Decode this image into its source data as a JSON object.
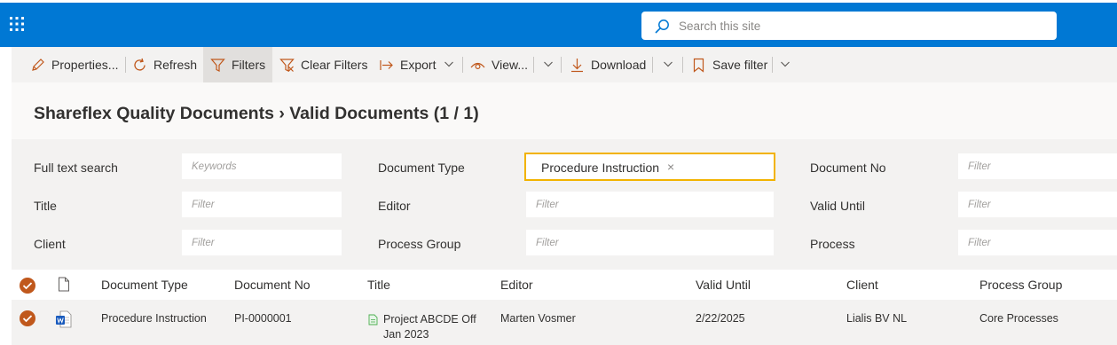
{
  "search": {
    "placeholder": "Search this site"
  },
  "commands": {
    "properties": "Properties...",
    "refresh": "Refresh",
    "filters": "Filters",
    "clear_filters": "Clear Filters",
    "export": "Export",
    "view": "View...",
    "download": "Download",
    "save_filter": "Save filter"
  },
  "page_title": "Shareflex Quality Documents › Valid Documents (1 / 1)",
  "filters": {
    "full_text_search": {
      "label": "Full text search",
      "placeholder": "Keywords"
    },
    "document_type": {
      "label": "Document Type",
      "selected_tag": "Procedure Instruction",
      "remove_glyph": "×"
    },
    "document_no": {
      "label": "Document No",
      "placeholder": "Filter"
    },
    "title": {
      "label": "Title",
      "placeholder": "Filter"
    },
    "editor": {
      "label": "Editor",
      "placeholder": "Filter"
    },
    "valid_until": {
      "label": "Valid Until",
      "placeholder": "Filter"
    },
    "client": {
      "label": "Client",
      "placeholder": "Filter"
    },
    "process_group": {
      "label": "Process Group",
      "placeholder": "Filter"
    },
    "process": {
      "label": "Process",
      "placeholder": "Filter"
    }
  },
  "table": {
    "columns": [
      "Document Type",
      "Document No",
      "Title",
      "Editor",
      "Valid Until",
      "Client",
      "Process Group"
    ],
    "rows": [
      {
        "document_type": "Procedure Instruction",
        "document_no": "PI-0000001",
        "title_line1": "Project ABCDE Off",
        "title_line2": "Jan 2023",
        "editor": "Marten Vosmer",
        "valid_until": "2/22/2025",
        "client": "Lialis BV NL",
        "process_group": "Core Processes",
        "file_icon": "word-document-icon"
      }
    ]
  },
  "colors": {
    "suite_bar": "#0078d4",
    "accent_orange": "#c0581c",
    "filter_highlight": "#f2b300",
    "panel_bg": "#f3f2f1"
  }
}
